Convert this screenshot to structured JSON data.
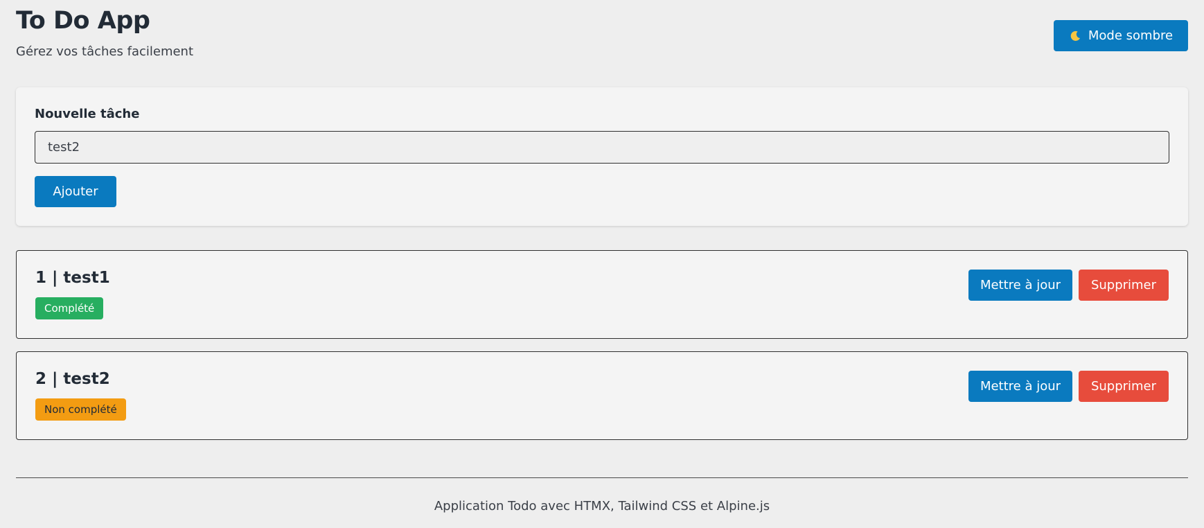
{
  "header": {
    "title": "To Do App",
    "subtitle": "Gérez vos tâches facilement",
    "theme_button": {
      "icon": "moon-icon",
      "label": "Mode sombre"
    }
  },
  "form": {
    "label": "Nouvelle tâche",
    "input_value": "test2",
    "submit_label": "Ajouter"
  },
  "tasks": [
    {
      "title": "1 | test1",
      "status": "Complété",
      "status_color": "#27ae60",
      "update_label": "Mettre à jour",
      "delete_label": "Supprimer"
    },
    {
      "title": "2 | test2",
      "status": "Non complété",
      "status_color": "#f39c12",
      "update_label": "Mettre à jour",
      "delete_label": "Supprimer"
    }
  ],
  "footer": {
    "text": "Application Todo avec HTMX, Tailwind CSS et Alpine.js"
  },
  "colors": {
    "primary": "#0a7abf",
    "danger": "#e74c3c",
    "success": "#27ae60",
    "warning": "#f39c12",
    "background": "#eeeeee"
  }
}
